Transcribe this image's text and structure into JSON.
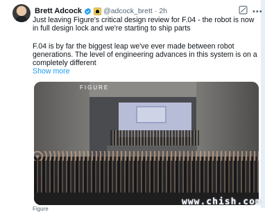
{
  "post": {
    "author_name": "Brett Adcock",
    "handle": "@adcock_brett",
    "separator": "·",
    "time": "2h",
    "paragraph_1": "Just leaving Figure's critical design review for F.04 - the robot is now in full design lock and we're starting to ship parts",
    "paragraph_2": "F.04 is by far the biggest leap we've ever made between robot generations. The level of engineering advances in this system is on a completely different",
    "show_more": "Show more",
    "media": {
      "logo_text": "FIGURE"
    },
    "caption": "Figure"
  },
  "watermark": "www.chish.com",
  "icons": {
    "verified": "verified-badge-icon",
    "affiliate": "affiliate-badge-icon",
    "grok": "grok-icon",
    "more": "more-options-icon"
  },
  "colors": {
    "link": "#1d9bf0",
    "verified": "#1d9bf0",
    "muted": "#536471"
  }
}
